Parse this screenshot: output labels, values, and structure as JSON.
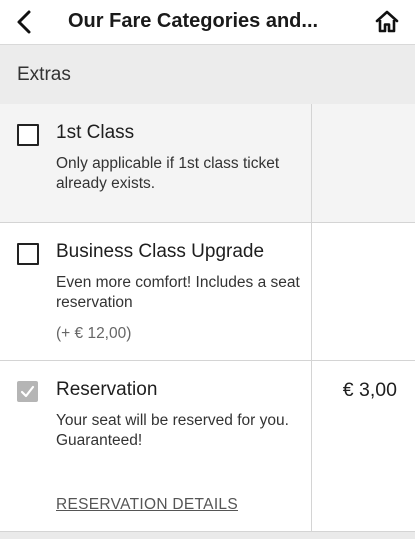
{
  "header": {
    "title": "Our Fare Categories and...",
    "back_icon": "chevron-left-icon",
    "home_icon": "home-icon"
  },
  "section": {
    "label": "Extras"
  },
  "items": [
    {
      "title": "1st Class",
      "description": "Only applicable if 1st class ticket already exists.",
      "checked": false
    },
    {
      "title": "Business Class Upgrade",
      "description": "Even more comfort! Includes a seat reservation",
      "price_note": "(+ € 12,00)",
      "checked": false
    },
    {
      "title": "Reservation",
      "description": "Your seat will be reserved for you. Guaranteed!",
      "price": "€ 3,00",
      "checked": true,
      "link_label": "RESERVATION DETAILS"
    }
  ],
  "colors": {
    "section_bg": "#ececec",
    "disabled_check": "#b5b5b5"
  }
}
